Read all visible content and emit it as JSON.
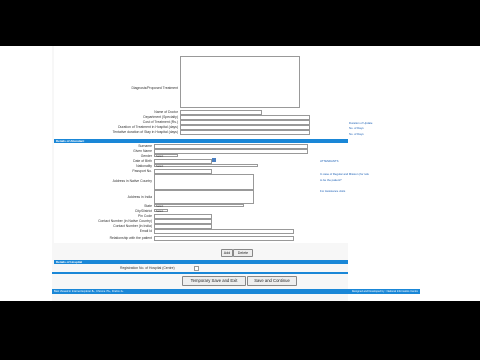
{
  "form": {
    "diagnosis_label": "Diagnosis/Proposed Treatment",
    "doctor_name_label": "Name of Doctor",
    "department_label": "Department (Specialty)",
    "treatment_cost_label": "Cost of Treatment (Rs.)",
    "duration_label": "Duration of Treatment in Hospital (days)",
    "tentative_stay_label": "Tentative duration of Stay in Hospital (days)"
  },
  "attendant": {
    "header": "Details of Attendant",
    "surname_label": "Surname",
    "given_name_label": "Given Name",
    "gender_label": "Gender",
    "gender_value": "Select",
    "dob_label": "Date of Birth",
    "nationality_label": "Nationality",
    "nationality_value": "Select",
    "passport_label": "Passport No.",
    "address_home_label": "Address in Native Country",
    "address_india_label": "Address in India",
    "state_label": "State",
    "state_value": "Select",
    "city_label": "City/District",
    "city_value": "Select",
    "pincode_label": "Pin Code",
    "contact_native_label": "Contact Number (in Native Country)",
    "contact_india_label": "Contact Number (in India)",
    "email_label": "Email Id",
    "relation_label": "Relationship with the patient",
    "add_button": "Add",
    "delete_button": "Delete"
  },
  "hospital": {
    "header": "Details of Hospital",
    "reg_label": "Registration No. of Hospital (Centre)"
  },
  "actions": {
    "temp_save": "Temporary Save and Exit",
    "save_continue": "Save and Continue"
  },
  "side": {
    "duration_title": "Duration of Update",
    "days_1": "No. of Days",
    "days_2": "No. of Days",
    "attendant_title": "ATTENDANTS",
    "note_1": "In case of Regular and Mission (for refe",
    "note_2": "to be the patient?",
    "note_3": "For Assistance visits"
  },
  "footer": {
    "left": "Best Viewed in Internet Explorer 8+, Chrome 70+, Firefox 4+",
    "right": "Designed and Developed by : National Informatics Centre"
  },
  "colors": {
    "accent": "#1a87d7",
    "background": "#000000"
  }
}
